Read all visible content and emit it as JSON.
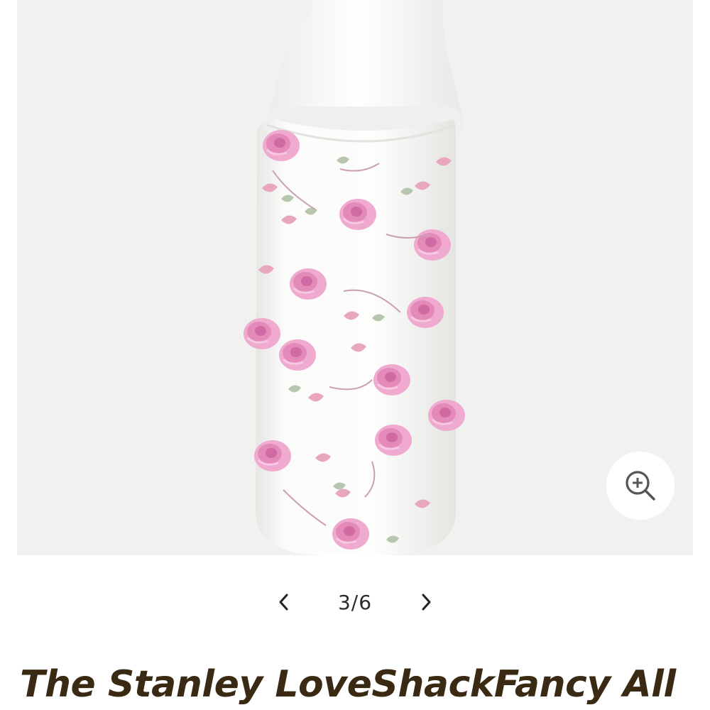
{
  "gallery": {
    "image_alt": "Stanley LoveShackFancy floral water bottle",
    "zoom_icon": "zoom-in-icon"
  },
  "pager": {
    "prev_icon": "chevron-left-icon",
    "counter": "3/6",
    "next_icon": "chevron-right-icon"
  },
  "product": {
    "title": "The Stanley LoveShackFancy All"
  },
  "colors": {
    "gallery_bg": "#f1f1ef",
    "title": "#3a2a14",
    "rose": "#e79ac3"
  }
}
